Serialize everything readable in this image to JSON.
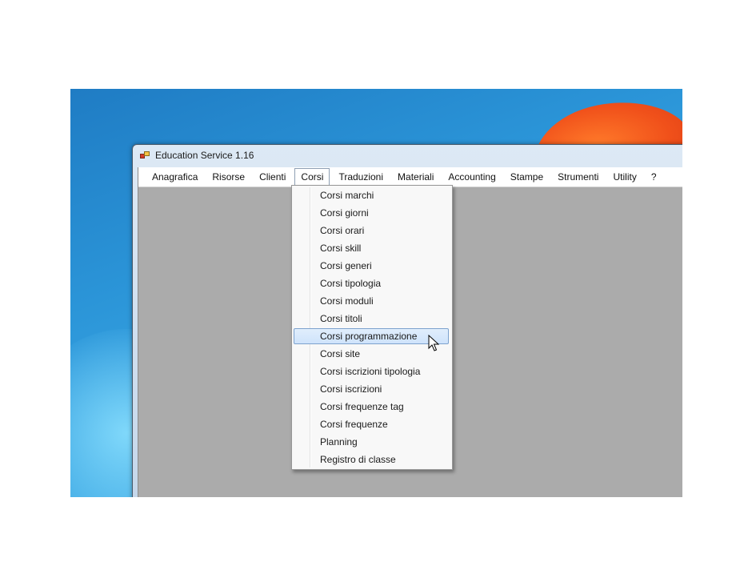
{
  "window": {
    "title": "Education Service 1.16"
  },
  "menubar": {
    "items": [
      "Anagrafica",
      "Risorse",
      "Clienti",
      "Corsi",
      "Traduzioni",
      "Materiali",
      "Accounting",
      "Stampe",
      "Strumenti",
      "Utility",
      "?"
    ],
    "open_item": "Corsi"
  },
  "dropdown": {
    "items": [
      "Corsi marchi",
      "Corsi giorni",
      "Corsi orari",
      "Corsi skill",
      "Corsi generi",
      "Corsi tipologia",
      "Corsi moduli",
      "Corsi titoli",
      "Corsi programmazione",
      "Corsi site",
      "Corsi iscrizioni tipologia",
      "Corsi iscrizioni",
      "Corsi frequenze tag",
      "Corsi frequenze",
      "Planning",
      "Registro di classe"
    ],
    "highlighted_item": "Corsi programmazione"
  },
  "icons": {
    "app_icon": "app-icon",
    "cursor": "mouse-pointer-icon"
  },
  "colors": {
    "client_area": "#ababab",
    "highlight_border": "#7da2ce",
    "highlight_fill": "#d9e9fb"
  }
}
